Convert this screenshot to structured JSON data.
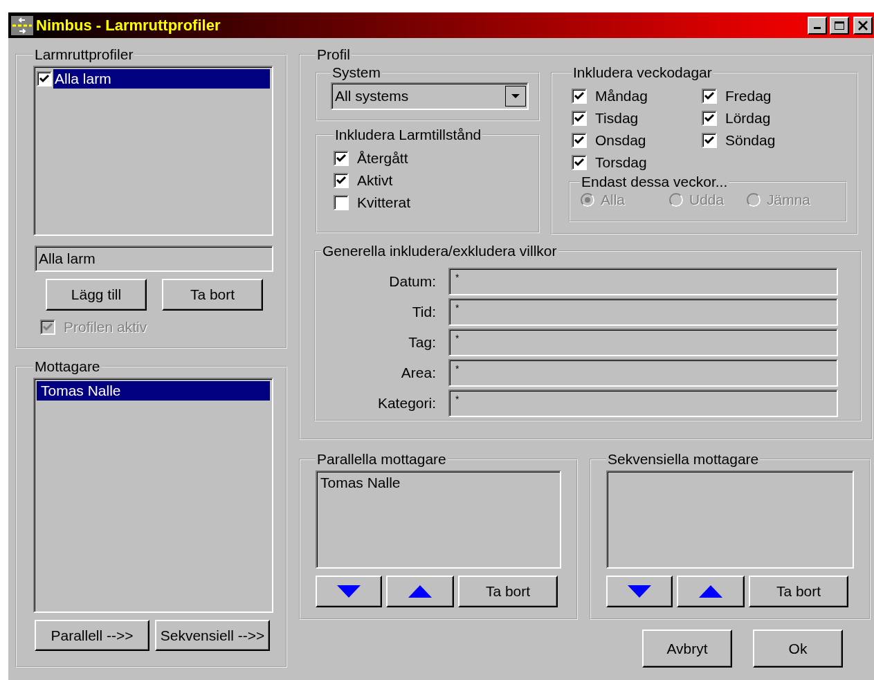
{
  "window": {
    "title": "Nimbus - Larmruttprofiler"
  },
  "profiles": {
    "label": "Larmruttprofiler",
    "list": [
      {
        "label": "Alla larm",
        "checked": true,
        "selected": true
      }
    ],
    "name_value": "Alla larm",
    "buttons": [
      "Lägg till",
      "Ta bort"
    ],
    "active": {
      "label": "Profilen aktiv",
      "checked": true,
      "disabled": true
    }
  },
  "recipients": {
    "label": "Mottagare",
    "list": [
      {
        "label": "Tomas Nalle",
        "selected": true
      }
    ],
    "buttons": [
      "Parallell -->>",
      "Sekvensiell -->>"
    ]
  },
  "profile": {
    "label": "Profil",
    "system": {
      "label": "System",
      "value": "All systems"
    },
    "alarm_states": {
      "label": "Inkludera Larmtillstånd",
      "items": [
        {
          "label": "Återgått",
          "checked": true
        },
        {
          "label": "Aktivt",
          "checked": true
        },
        {
          "label": "Kvitterat",
          "checked": false
        }
      ]
    },
    "weekdays": {
      "label": "Inkludera veckodagar",
      "items": [
        {
          "label": "Måndag",
          "checked": true
        },
        {
          "label": "Tisdag",
          "checked": true
        },
        {
          "label": "Onsdag",
          "checked": true
        },
        {
          "label": "Torsdag",
          "checked": true
        },
        {
          "label": "Fredag",
          "checked": true
        },
        {
          "label": "Lördag",
          "checked": true
        },
        {
          "label": "Söndag",
          "checked": true
        }
      ]
    },
    "weeks": {
      "label": "Endast dessa veckor...",
      "disabled": true,
      "options": [
        {
          "label": "Alla",
          "selected": true
        },
        {
          "label": "Udda",
          "selected": false
        },
        {
          "label": "Jämna",
          "selected": false
        }
      ]
    },
    "conditions": {
      "label": "Generella inkludera/exkludera villkor",
      "fields": [
        {
          "label": "Datum:",
          "value": "*"
        },
        {
          "label": "Tid:",
          "value": "*"
        },
        {
          "label": "Tag:",
          "value": "*"
        },
        {
          "label": "Area:",
          "value": "*"
        },
        {
          "label": "Kategori:",
          "value": "*"
        }
      ]
    }
  },
  "parallel": {
    "label": "Parallella mottagare",
    "list": [
      {
        "label": "Tomas Nalle"
      }
    ],
    "buttons": [
      {
        "kind": "down"
      },
      {
        "kind": "up"
      },
      {
        "kind": "text",
        "label": "Ta bort"
      }
    ]
  },
  "sequential": {
    "label": "Sekvensiella mottagare",
    "buttons": [
      {
        "kind": "down"
      },
      {
        "kind": "up"
      },
      {
        "kind": "text",
        "label": "Ta bort"
      }
    ]
  },
  "footer_buttons": [
    "Avbryt",
    "Ok"
  ]
}
